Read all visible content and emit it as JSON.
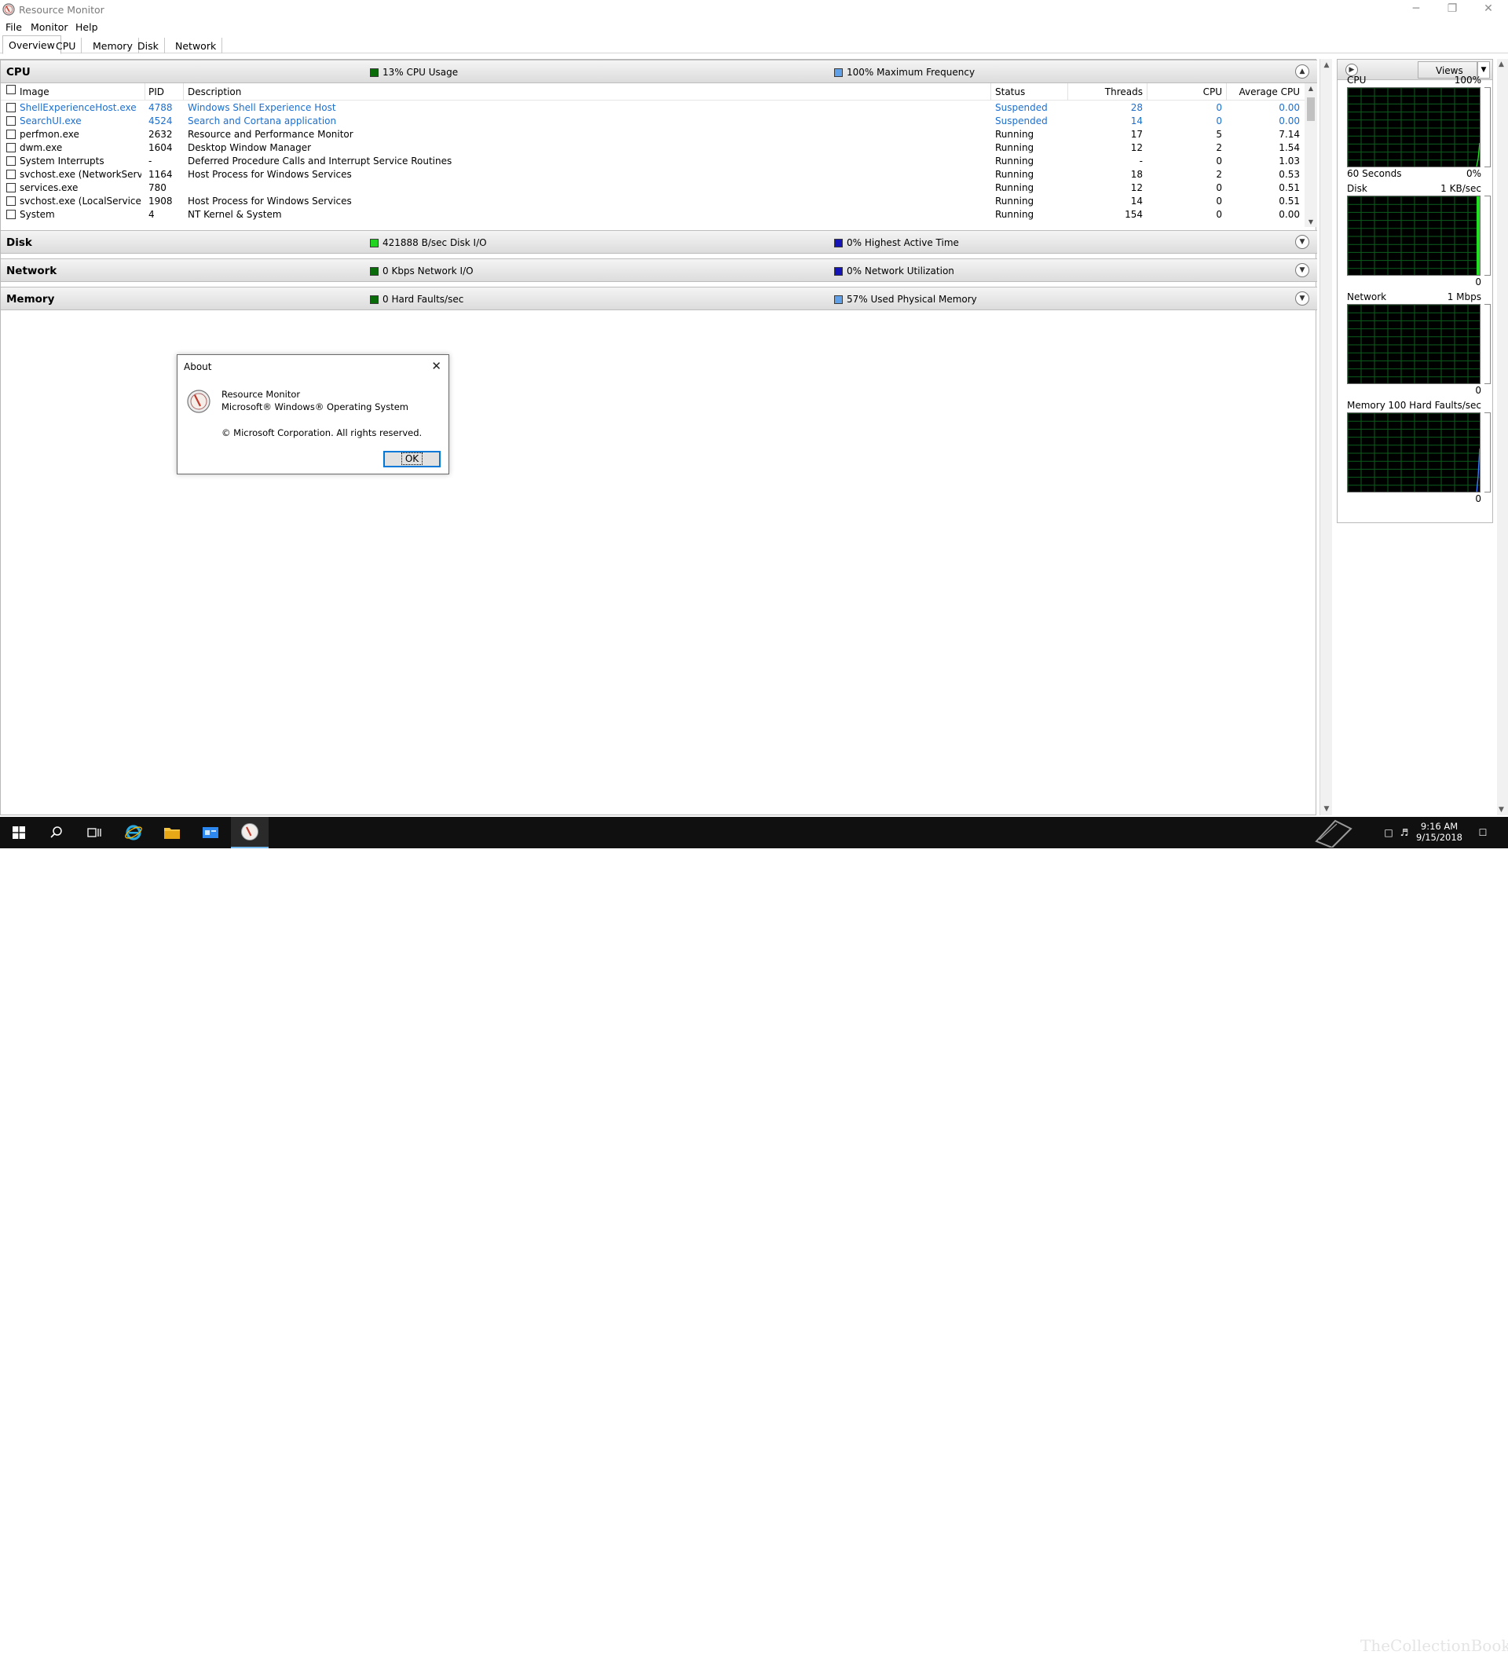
{
  "window": {
    "title": "Resource Monitor",
    "minimize_glyph": "─",
    "restore_glyph": "❐",
    "close_glyph": "✕"
  },
  "menu": [
    "File",
    "Monitor",
    "Help"
  ],
  "tabs": [
    "Overview",
    "CPU",
    "Memory",
    "Disk",
    "Network"
  ],
  "cpu_section": {
    "title": "CPU",
    "stat1": {
      "text": "13% CPU Usage",
      "color": "#0a6b0a"
    },
    "stat2": {
      "text": "100% Maximum Frequency",
      "color": "#5fa0e8"
    },
    "columns": [
      "Image",
      "PID",
      "Description",
      "Status",
      "Threads",
      "CPU",
      "Average CPU"
    ],
    "rows": [
      {
        "image": "ShellExperienceHost.exe",
        "pid": "4788",
        "description": "Windows Shell Experience Host",
        "status": "Suspended",
        "threads": "28",
        "cpu": "0",
        "avg_cpu": "0.00",
        "suspended": true
      },
      {
        "image": "SearchUI.exe",
        "pid": "4524",
        "description": "Search and Cortana application",
        "status": "Suspended",
        "threads": "14",
        "cpu": "0",
        "avg_cpu": "0.00",
        "suspended": true
      },
      {
        "image": "perfmon.exe",
        "pid": "2632",
        "description": "Resource and Performance Monitor",
        "status": "Running",
        "threads": "17",
        "cpu": "5",
        "avg_cpu": "7.14",
        "suspended": false
      },
      {
        "image": "dwm.exe",
        "pid": "1604",
        "description": "Desktop Window Manager",
        "status": "Running",
        "threads": "12",
        "cpu": "2",
        "avg_cpu": "1.54",
        "suspended": false
      },
      {
        "image": "System Interrupts",
        "pid": "-",
        "description": "Deferred Procedure Calls and Interrupt Service Routines",
        "status": "Running",
        "threads": "-",
        "cpu": "0",
        "avg_cpu": "1.03",
        "suspended": false
      },
      {
        "image": "svchost.exe (NetworkService...",
        "pid": "1164",
        "description": "Host Process for Windows Services",
        "status": "Running",
        "threads": "18",
        "cpu": "2",
        "avg_cpu": "0.53",
        "suspended": false
      },
      {
        "image": "services.exe",
        "pid": "780",
        "description": "",
        "status": "Running",
        "threads": "12",
        "cpu": "0",
        "avg_cpu": "0.51",
        "suspended": false
      },
      {
        "image": "svchost.exe (LocalServiceNo...",
        "pid": "1908",
        "description": "Host Process for Windows Services",
        "status": "Running",
        "threads": "14",
        "cpu": "0",
        "avg_cpu": "0.51",
        "suspended": false
      },
      {
        "image": "System",
        "pid": "4",
        "description": "NT Kernel & System",
        "status": "Running",
        "threads": "154",
        "cpu": "0",
        "avg_cpu": "0.00",
        "suspended": false
      }
    ]
  },
  "disk_section": {
    "title": "Disk",
    "stat1": {
      "text": "421888 B/sec Disk I/O",
      "color": "#22d422"
    },
    "stat2": {
      "text": "0% Highest Active Time",
      "color": "#1414b8"
    }
  },
  "network_section": {
    "title": "Network",
    "stat1": {
      "text": "0 Kbps Network I/O",
      "color": "#0a6b0a"
    },
    "stat2": {
      "text": "0% Network Utilization",
      "color": "#1414b8"
    }
  },
  "memory_section": {
    "title": "Memory",
    "stat1": {
      "text": "0 Hard Faults/sec",
      "color": "#0a6b0a"
    },
    "stat2": {
      "text": "57% Used Physical Memory",
      "color": "#5fa0e8"
    }
  },
  "right_panel": {
    "views_label": "Views",
    "graphs": [
      {
        "name": "CPU",
        "max": "100%",
        "bottom_left": "60 Seconds",
        "bottom_right": "0%"
      },
      {
        "name": "Disk",
        "max": "1 KB/sec",
        "bottom_left": "",
        "bottom_right": "0"
      },
      {
        "name": "Network",
        "max": "1 Mbps",
        "bottom_left": "",
        "bottom_right": "0"
      },
      {
        "name": "Memory",
        "max": "100 Hard Faults/sec",
        "bottom_left": "",
        "bottom_right": "0"
      }
    ]
  },
  "about_dialog": {
    "title": "About",
    "line1": "Resource Monitor",
    "line2": "Microsoft® Windows® Operating System",
    "line3": "© Microsoft Corporation. All rights reserved.",
    "ok_label": "OK"
  },
  "taskbar": {
    "time": "9:16 AM",
    "date": "9/15/2018",
    "watermark": "TheCollectionBook"
  }
}
